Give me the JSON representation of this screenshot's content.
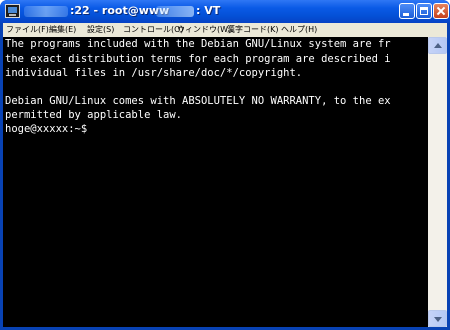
{
  "window": {
    "title_left": ":22 - root@www",
    "title_right": ": VT",
    "icon": "terminal-icon",
    "controls": [
      "minimize-icon",
      "maximize-icon",
      "close-icon"
    ]
  },
  "menu": {
    "items": [
      {
        "label": "ファイル(F)"
      },
      {
        "label": "編集(E)"
      },
      {
        "label": "設定(S)"
      },
      {
        "label": "コントロール(O)"
      },
      {
        "label": "ウィンドウ(W)"
      },
      {
        "label": "漢字コード(K)"
      },
      {
        "label": "ヘルプ(H)"
      }
    ]
  },
  "terminal": {
    "lines": [
      "The programs included with the Debian GNU/Linux system are fr",
      "the exact distribution terms for each program are described i",
      "individual files in /usr/share/doc/*/copyright.",
      "",
      "Debian GNU/Linux comes with ABSOLUTELY NO WARRANTY, to the ex",
      "permitted by applicable law.",
      "hoge@xxxxx:~$"
    ],
    "colors": {
      "background": "#000000",
      "text": "#ffffff"
    }
  },
  "colors": {
    "titlebar": "#0a5ae6",
    "menubar": "#ece9d8",
    "close_button": "#c4401c"
  }
}
